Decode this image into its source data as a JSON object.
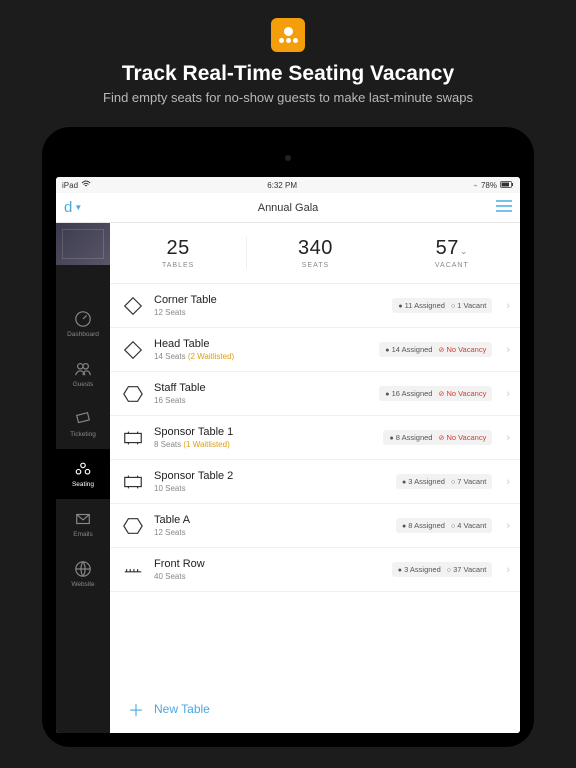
{
  "hero": {
    "title": "Track Real-Time Seating Vacancy",
    "subtitle": "Find empty seats for no-show guests to make last-minute swaps"
  },
  "status": {
    "device": "iPad",
    "time": "6:32 PM",
    "battery": "78%"
  },
  "nav": {
    "brand": "d",
    "title": "Annual Gala"
  },
  "sidebar": {
    "items": [
      {
        "label": "Dashboard"
      },
      {
        "label": "Guests"
      },
      {
        "label": "Ticketing"
      },
      {
        "label": "Seating"
      },
      {
        "label": "Emails"
      },
      {
        "label": "Website"
      }
    ]
  },
  "stats": {
    "tables": {
      "value": "25",
      "label": "TABLES"
    },
    "seats": {
      "value": "340",
      "label": "SEATS"
    },
    "vacant": {
      "value": "57",
      "label": "VACANT"
    }
  },
  "tables": [
    {
      "name": "Corner Table",
      "seats": "12 Seats",
      "waitlist": "",
      "assigned": "11 Assigned",
      "vacancy": "1 Vacant",
      "novac": false
    },
    {
      "name": "Head Table",
      "seats": "14 Seats",
      "waitlist": "(2 Waitlisted)",
      "assigned": "14 Assigned",
      "vacancy": "No Vacancy",
      "novac": true
    },
    {
      "name": "Staff Table",
      "seats": "16 Seats",
      "waitlist": "",
      "assigned": "16 Assigned",
      "vacancy": "No Vacancy",
      "novac": true
    },
    {
      "name": "Sponsor Table 1",
      "seats": "8 Seats",
      "waitlist": "(1 Waitlisted)",
      "assigned": "8 Assigned",
      "vacancy": "No Vacancy",
      "novac": true
    },
    {
      "name": "Sponsor Table 2",
      "seats": "10 Seats",
      "waitlist": "",
      "assigned": "3 Assigned",
      "vacancy": "7 Vacant",
      "novac": false
    },
    {
      "name": "Table A",
      "seats": "12 Seats",
      "waitlist": "",
      "assigned": "8 Assigned",
      "vacancy": "4 Vacant",
      "novac": false
    },
    {
      "name": "Front Row",
      "seats": "40 Seats",
      "waitlist": "",
      "assigned": "3 Assigned",
      "vacancy": "37 Vacant",
      "novac": false
    }
  ],
  "new_table": "New Table"
}
